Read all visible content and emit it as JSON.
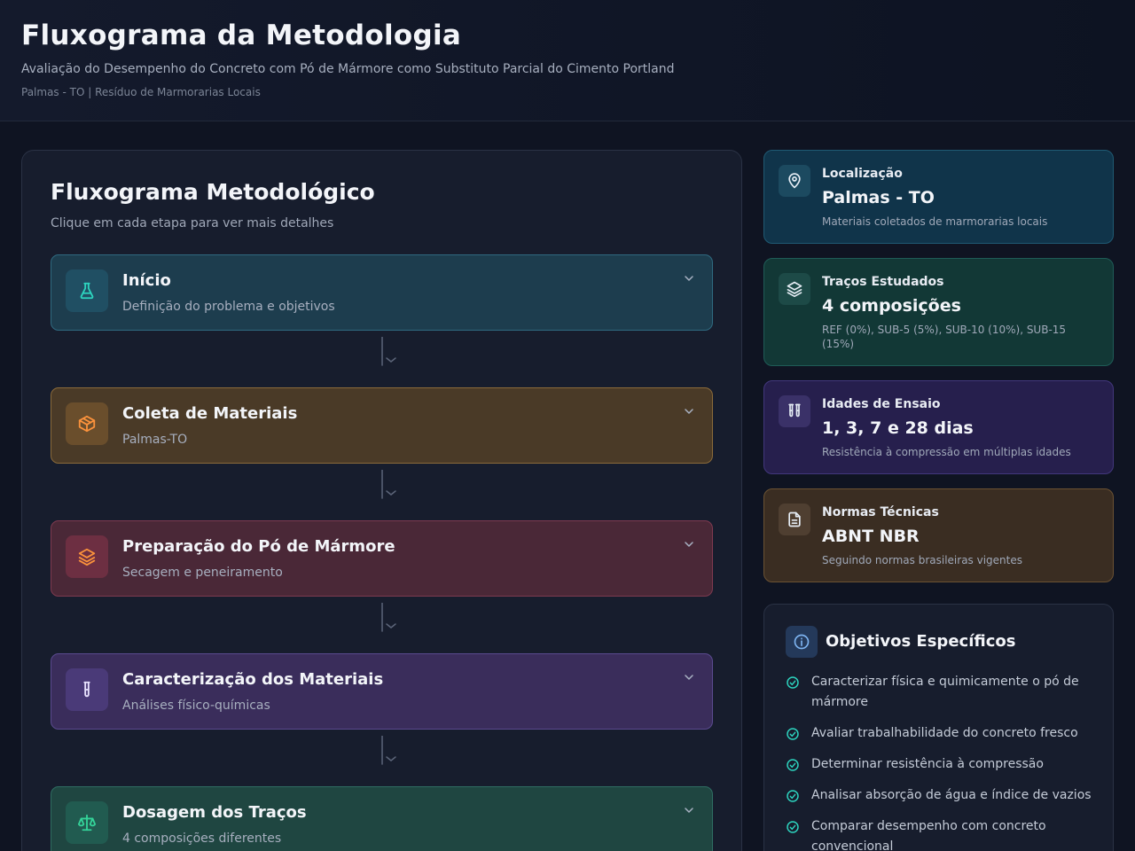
{
  "header": {
    "title": "Fluxograma da Metodologia",
    "subtitle": "Avaliação do Desempenho do Concreto com Pó de Mármore como Substituto Parcial do Cimento Portland",
    "meta": "Palmas - TO | Resíduo de Marmorarias Locais"
  },
  "flow": {
    "title": "Fluxograma Metodológico",
    "hint": "Clique em cada etapa para ver mais detalhes",
    "steps": [
      {
        "title": "Início",
        "desc": "Definição do problema e objetivos",
        "icon": "flask-icon"
      },
      {
        "title": "Coleta de Materiais",
        "desc": "Palmas-TO",
        "icon": "box-icon"
      },
      {
        "title": "Preparação do Pó de Mármore",
        "desc": "Secagem e peneiramento",
        "icon": "layers-icon"
      },
      {
        "title": "Caracterização dos Materiais",
        "desc": "Análises físico-químicas",
        "icon": "test-tube-icon"
      },
      {
        "title": "Dosagem dos Traços",
        "desc": "4 composições diferentes",
        "icon": "scale-icon"
      }
    ]
  },
  "cards": [
    {
      "label": "Localização",
      "value": "Palmas - TO",
      "desc": "Materiais coletados de marmorarias locais",
      "icon": "map-pin-icon"
    },
    {
      "label": "Traços Estudados",
      "value": "4 composições",
      "desc": "REF (0%), SUB-5 (5%), SUB-10 (10%), SUB-15 (15%)",
      "icon": "layers-icon"
    },
    {
      "label": "Idades de Ensaio",
      "value": "1, 3, 7 e 28 dias",
      "desc": "Resistência à compressão em múltiplas idades",
      "icon": "test-tubes-icon"
    },
    {
      "label": "Normas Técnicas",
      "value": "ABNT NBR",
      "desc": "Seguindo normas brasileiras vigentes",
      "icon": "document-icon"
    }
  ],
  "objectives": {
    "title": "Objetivos Específicos",
    "items": [
      "Caracterizar física e quimicamente o pó de mármore",
      "Avaliar trabalhabilidade do concreto fresco",
      "Determinar resistência à compressão",
      "Analisar absorção de água e índice de vazios",
      "Comparar desempenho com concreto convencional"
    ]
  },
  "colors": {
    "background": "#0f1422",
    "teal": "#2dd4bf",
    "orange": "#fb923c",
    "rose": "#fb7185",
    "violet": "#c4b5fd",
    "green": "#34d399"
  }
}
